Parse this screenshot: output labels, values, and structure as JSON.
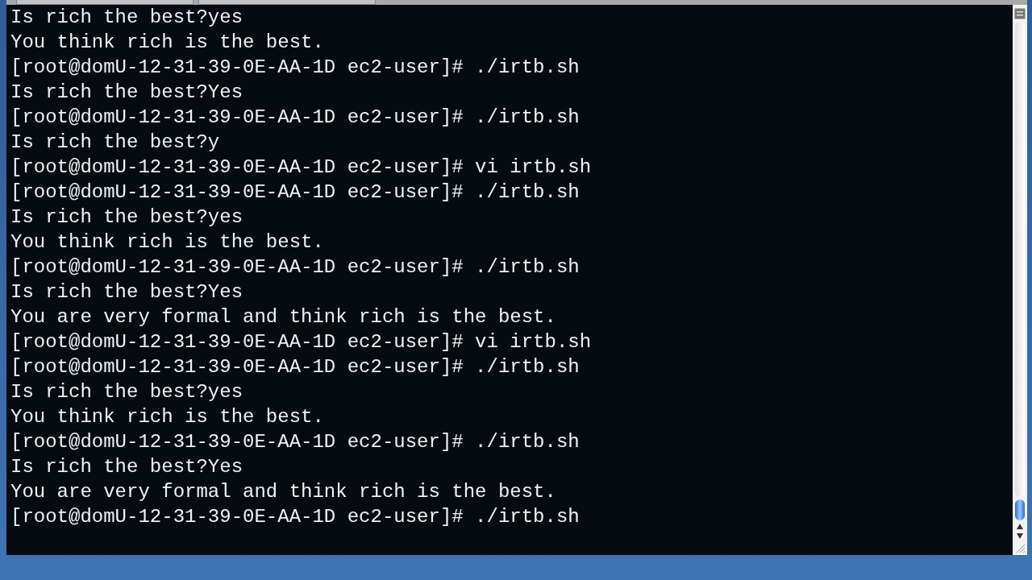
{
  "terminal": {
    "lines": [
      "Is rich the best?yes",
      "You think rich is the best.",
      "[root@domU-12-31-39-0E-AA-1D ec2-user]# ./irtb.sh",
      "Is rich the best?Yes",
      "[root@domU-12-31-39-0E-AA-1D ec2-user]# ./irtb.sh",
      "Is rich the best?y",
      "[root@domU-12-31-39-0E-AA-1D ec2-user]# vi irtb.sh",
      "[root@domU-12-31-39-0E-AA-1D ec2-user]# ./irtb.sh",
      "Is rich the best?yes",
      "You think rich is the best.",
      "[root@domU-12-31-39-0E-AA-1D ec2-user]# ./irtb.sh",
      "Is rich the best?Yes",
      "You are very formal and think rich is the best.",
      "[root@domU-12-31-39-0E-AA-1D ec2-user]# vi irtb.sh",
      "[root@domU-12-31-39-0E-AA-1D ec2-user]# ./irtb.sh",
      "Is rich the best?yes",
      "You think rich is the best.",
      "[root@domU-12-31-39-0E-AA-1D ec2-user]# ./irtb.sh",
      "Is rich the best?Yes",
      "You are very formal and think rich is the best.",
      "[root@domU-12-31-39-0E-AA-1D ec2-user]# ./irtb.sh"
    ]
  }
}
